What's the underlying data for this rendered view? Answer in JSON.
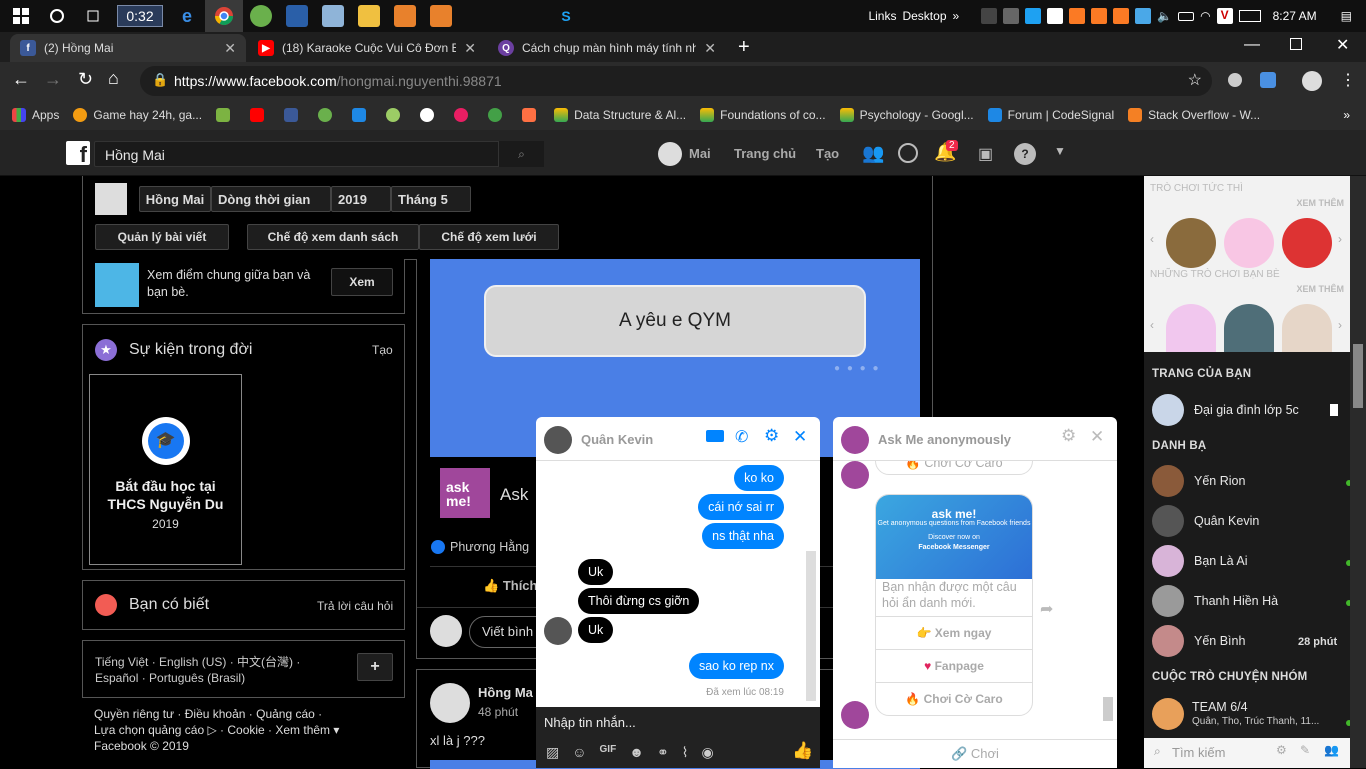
{
  "taskbar": {
    "time_box": "0:32",
    "links": "Links",
    "desktop": "Desktop",
    "clock": "8:27 AM"
  },
  "tabs": [
    {
      "label": "(2) Hồng Mai"
    },
    {
      "label": "(18) Karaoke Cuộc Vui Cô Đơn Be"
    },
    {
      "label": "Cách chụp màn hình máy tính nh"
    }
  ],
  "address": {
    "url_host": "https://www.facebook.com",
    "url_path": "/hongmai.nguyenthi.98871"
  },
  "bookmarks": [
    {
      "label": "Apps"
    },
    {
      "label": "Game hay 24h, ga..."
    },
    {
      "label": "Data Structure & Al..."
    },
    {
      "label": "Foundations of co..."
    },
    {
      "label": "Psychology - Googl..."
    },
    {
      "label": "Forum | CodeSignal"
    },
    {
      "label": "Stack Overflow - W..."
    }
  ],
  "fbheader": {
    "search_value": "Hồng Mai",
    "profile_name": "Mai",
    "home": "Trang chủ",
    "create": "Tạo",
    "notif_count": "2"
  },
  "profile_bar": {
    "name": "Hồng Mai",
    "timeline": "Dòng thời gian",
    "year": "2019",
    "month": "Tháng 5",
    "manage": "Quản lý bài viết",
    "list_view": "Chế độ xem danh sách",
    "grid_view": "Chế độ xem lưới"
  },
  "friendship": {
    "text_line1": "Xem điểm chung giữa bạn và",
    "text_line2": "bạn bè.",
    "button": "Xem"
  },
  "life_events": {
    "title": "Sự kiện trong đời",
    "create": "Tạo",
    "card_line1": "Bắt đầu học tại",
    "card_line2": "THCS Nguyễn Du",
    "card_year": "2019"
  },
  "did_you_know": {
    "title": "Bạn có biết",
    "answer": "Trả lời câu hỏi"
  },
  "languages": {
    "line1": "Tiếng Việt · English (US) · 中文(台灣) ·",
    "line2": "Español · Português (Brasil)",
    "plus": "+"
  },
  "footer": {
    "line1": "Quyền riêng tư · Điều khoản · Quảng cáo ·",
    "line2": "Lựa chọn quảng cáo ▷ · Cookie · Xem thêm ▾",
    "line3": "Facebook © 2019"
  },
  "post": {
    "banner_text": "A yêu e QYM",
    "app_name": "Ask",
    "liker": "Phương Hằng",
    "like_btn": "Thích",
    "comment_btn": "Viết bình",
    "askme_logo": "ask me!"
  },
  "post2": {
    "author": "Hồng Ma",
    "time": "48 phút",
    "text": "xl là j ???"
  },
  "chat1": {
    "name": "Quân Kevin",
    "messages_me": [
      "ko ko",
      "cái nớ sai rr",
      "ns thật nha",
      "sao ko rep nx"
    ],
    "messages_them": [
      "Uk",
      "Thôi đừng cs giỡn",
      "Uk"
    ],
    "seen": "Đã xem lúc 08:19",
    "input_placeholder": "Nhập tin nhắn..."
  },
  "chat2": {
    "name": "Ask Me anonymously",
    "top_option": "Chơi Cờ Caro",
    "card_caption_1": "Get anonymous questions from Facebook friends",
    "card_caption_2": "Discover now on",
    "card_caption_3": "Facebook Messenger",
    "card_text": "Bạn nhận được một câu hỏi ẩn danh mới.",
    "option1": "Xem ngay",
    "option2": "Fanpage",
    "option3": "Chơi Cờ Caro",
    "footer": "Chơi",
    "logo_text": "ask me!"
  },
  "rightbar": {
    "games_title": "TRÒ CHƠI TỨC THÌ",
    "see_more_1": "XEM THÊM",
    "games_title_2": "NHỮNG TRÒ CHƠI BẠN BÈ",
    "see_more_2": "XEM THÊM",
    "pages_title": "TRANG CỦA BẠN",
    "page1": "Đại gia đình lớp 5c",
    "contacts_title": "DANH BẠ",
    "contacts": [
      {
        "name": "Yến Rion",
        "status": ""
      },
      {
        "name": "Quân Kevin",
        "status": ""
      },
      {
        "name": "Bạn Là Ai",
        "status": ""
      },
      {
        "name": "Thanh Hiền Hà",
        "status": ""
      },
      {
        "name": "Yến Bình",
        "status": "28 phút"
      }
    ],
    "groups_title": "CUỘC TRÒ CHUYỆN NHÓM",
    "group_name": "TEAM 6/4",
    "group_members": "Quân, Tho, Trúc Thanh, 11...",
    "search_placeholder": "Tìm kiếm"
  },
  "colors": {
    "fb_blue": "#0084ff",
    "chrome_dark": "#2b2b2b",
    "messenger_icon": "#1877f2"
  }
}
